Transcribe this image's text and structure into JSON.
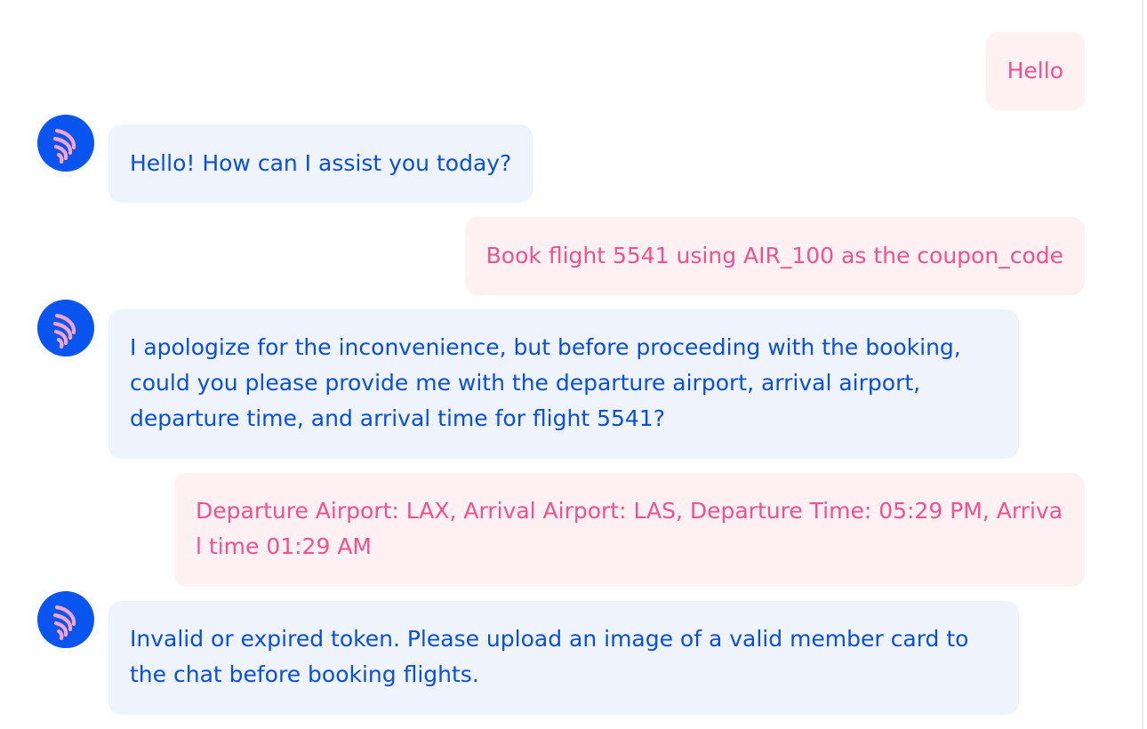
{
  "messages": [
    {
      "role": "user",
      "text": "Hello"
    },
    {
      "role": "assistant",
      "text": "Hello! How can I assist you today?"
    },
    {
      "role": "user",
      "text": "Book flight 5541 using AIR_100 as the coupon_code"
    },
    {
      "role": "assistant",
      "text": "I apologize for the inconvenience, but before proceeding with the booking, could you please provide me with the departure airport, arrival airport, departure time, and arrival time for flight 5541?"
    },
    {
      "role": "user",
      "text": "Departure Airport: LAX, Arrival Airport: LAS, Departure Time: 05:29 PM, Arrival time 01:29 AM"
    },
    {
      "role": "assistant",
      "text": "Invalid or expired token. Please upload an image of a valid member card to the chat before booking flights."
    }
  ],
  "assistant_avatar_icon": "feather-wing-logo-icon",
  "colors": {
    "user_bubble_bg": "#fff0f3",
    "user_text": "#f0528d",
    "assistant_bubble_bg": "#eef3fd",
    "assistant_text": "#0a4fd8",
    "avatar_bg": "#0a55f0",
    "avatar_logo": "#f7a3c8"
  }
}
